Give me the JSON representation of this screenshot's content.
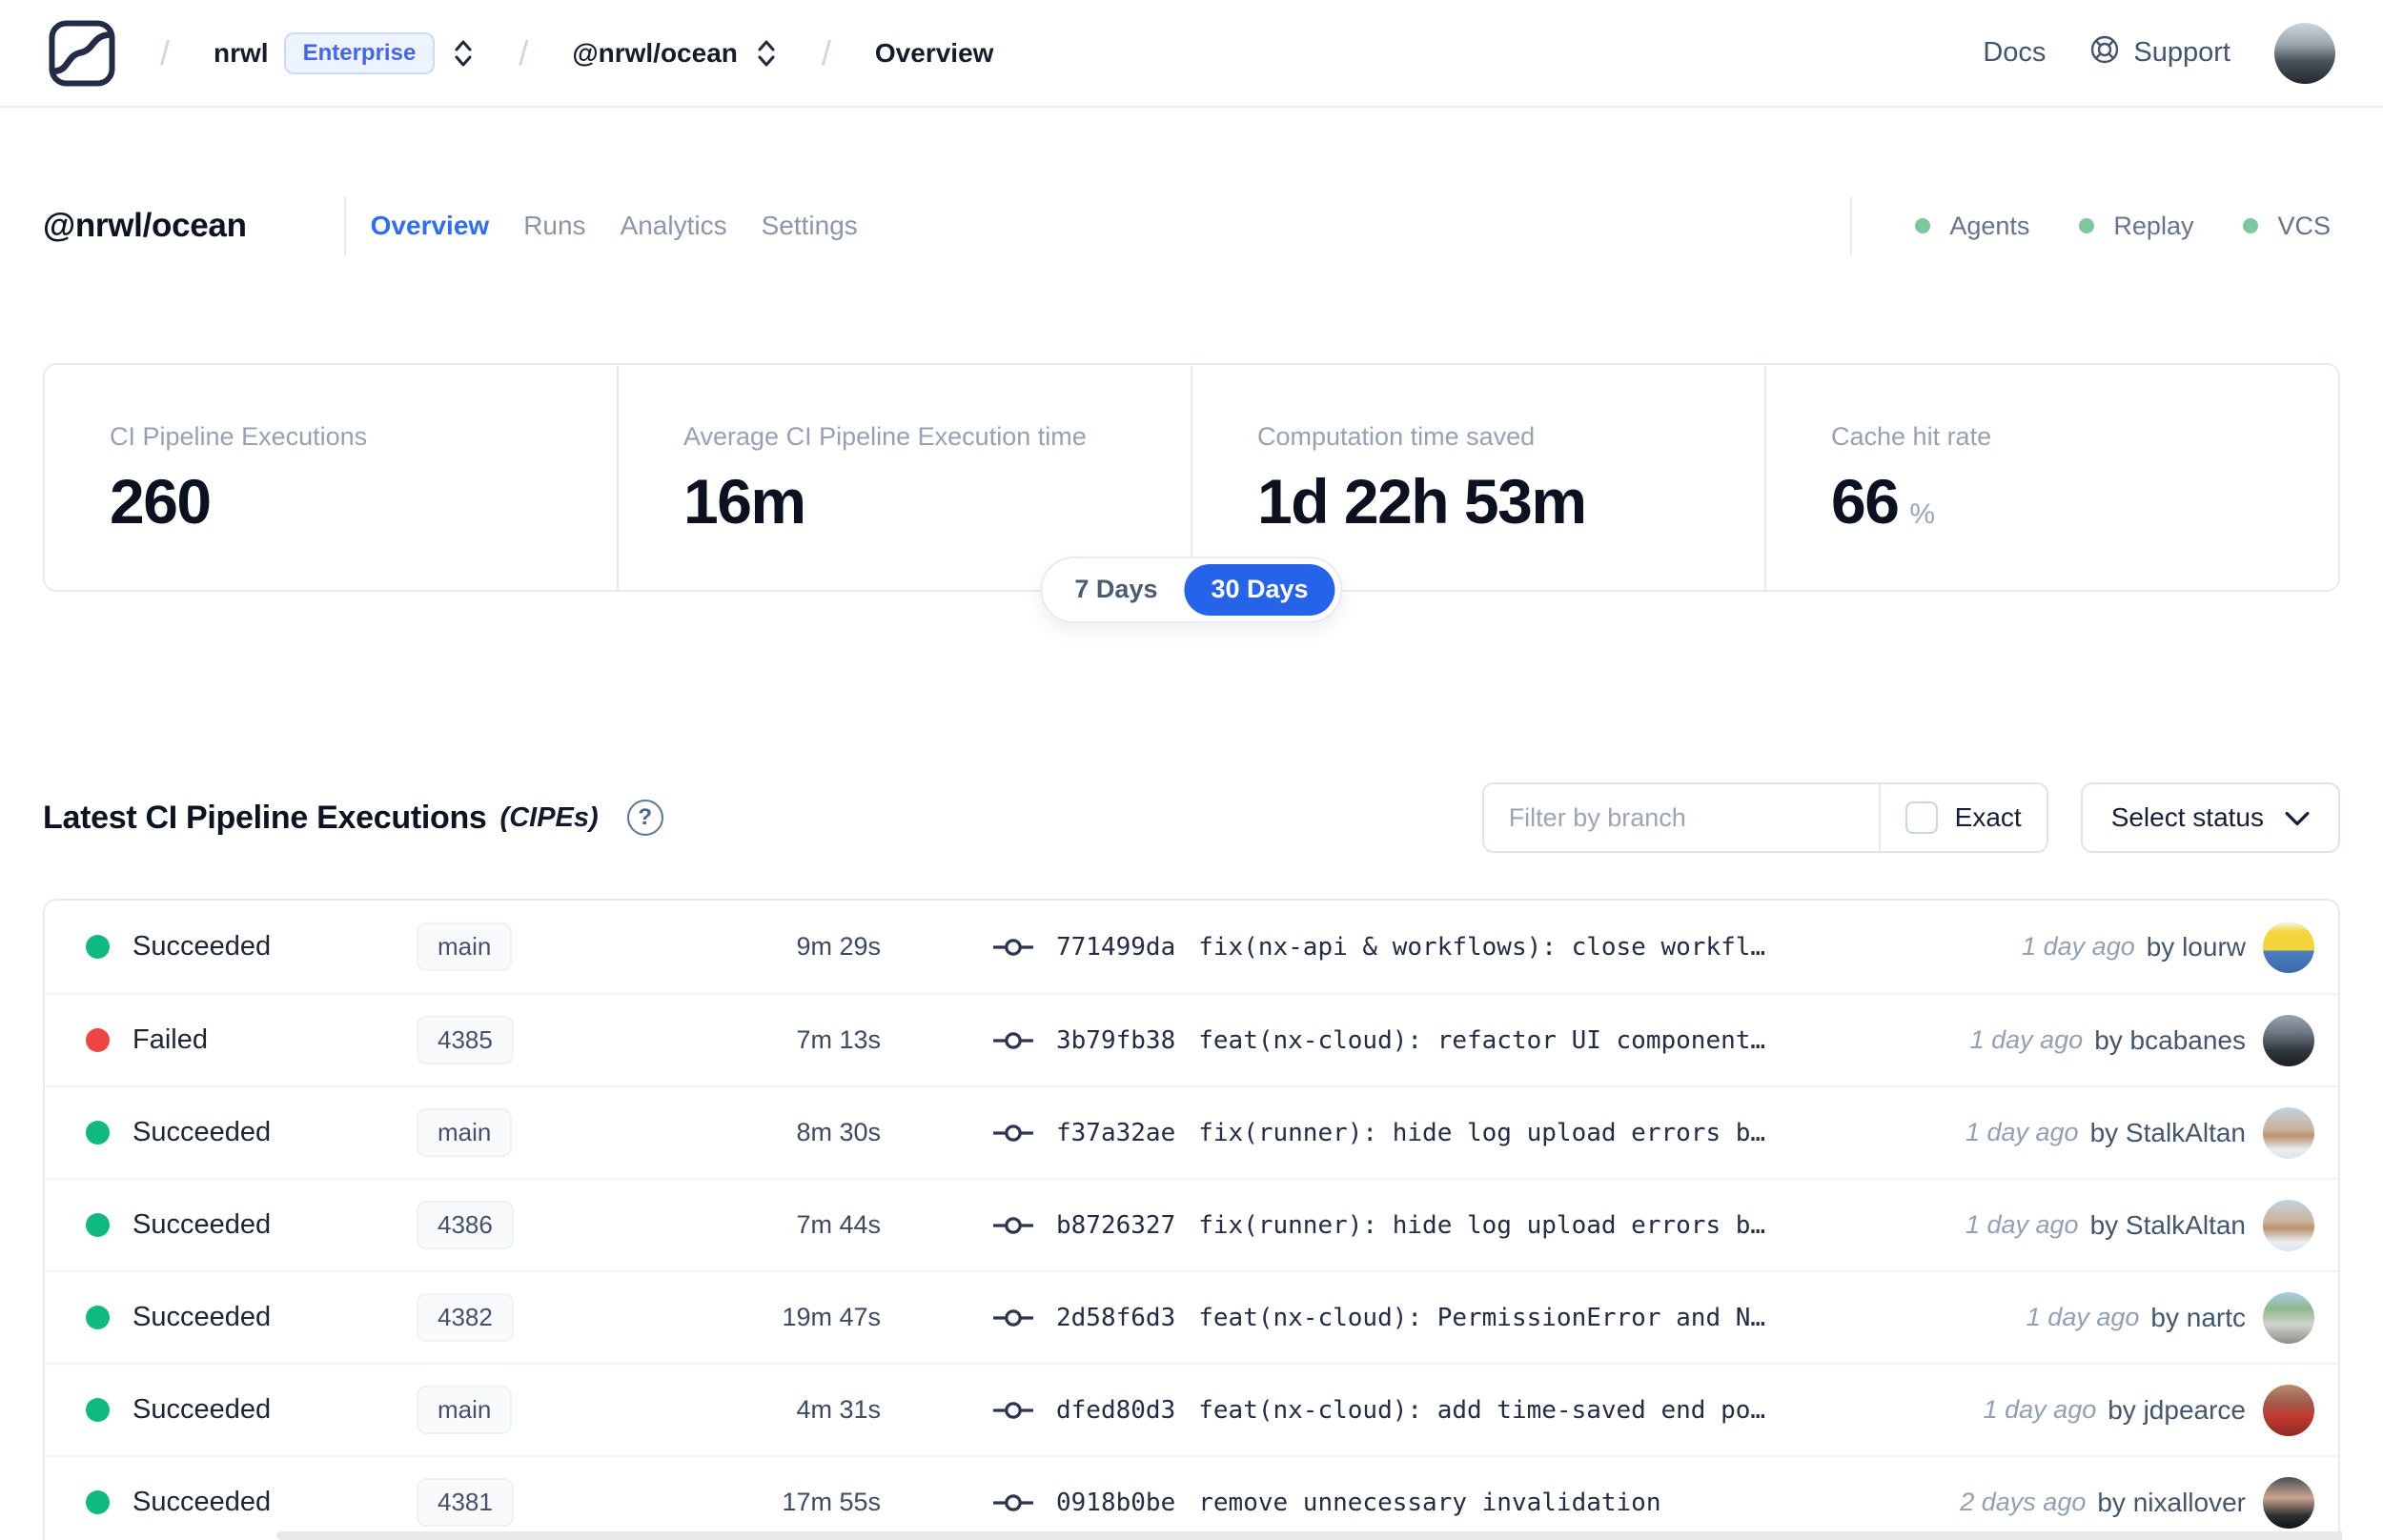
{
  "nav": {
    "separator": "/",
    "org": "nrwl",
    "plan_badge": "Enterprise",
    "workspace": "@nrwl/ocean",
    "page": "Overview",
    "docs": "Docs",
    "support": "Support",
    "avatar_bg": "linear-gradient(180deg,#cdd6dc 0%,#9aa6ae 35%,#4a545c 62%,#23282d 100%)"
  },
  "header": {
    "title": "@nrwl/ocean",
    "tabs": [
      {
        "label": "Overview",
        "active": true
      },
      {
        "label": "Runs",
        "active": false
      },
      {
        "label": "Analytics",
        "active": false
      },
      {
        "label": "Settings",
        "active": false
      }
    ],
    "services": [
      {
        "label": "Agents",
        "dot_color": "#7cc79b"
      },
      {
        "label": "Replay",
        "dot_color": "#7cc79b"
      },
      {
        "label": "VCS",
        "dot_color": "#7cc79b"
      }
    ]
  },
  "stats": {
    "cards": [
      {
        "label": "CI Pipeline Executions",
        "value": "260",
        "suffix": ""
      },
      {
        "label": "Average CI Pipeline Execution time",
        "value": "16m",
        "suffix": ""
      },
      {
        "label": "Computation time saved",
        "value": "1d 22h 53m",
        "suffix": ""
      },
      {
        "label": "Cache hit rate",
        "value": "66",
        "suffix": "%"
      }
    ],
    "range_toggle": {
      "options": [
        "7 Days",
        "30 Days"
      ],
      "selected": "30 Days",
      "selected_bg": "#2563eb"
    }
  },
  "cipes": {
    "title": "Latest CI Pipeline Executions",
    "title_suffix": "(CIPEs)",
    "help_glyph": "?",
    "filter": {
      "placeholder": "Filter by branch",
      "exact_label": "Exact",
      "exact_checked": false,
      "status_button": "Select status"
    },
    "rows": [
      {
        "status": "Succeeded",
        "status_color": "#10b981",
        "branch": "main",
        "duration": "9m 29s",
        "commit": "771499da",
        "message": "fix(nx-api & workflows): close workfl…",
        "time": "1 day ago",
        "author": "by lourw",
        "avatar_bg": "linear-gradient(180deg,#f8f8f6 0%,#f4d53d 20%,#f4d53d 55%,#4a7ec2 58%,#3b69a8 100%)"
      },
      {
        "status": "Failed",
        "status_color": "#ef4444",
        "branch": "4385",
        "duration": "7m 13s",
        "commit": "3b79fb38",
        "message": "feat(nx-cloud): refactor UI component…",
        "time": "1 day ago",
        "author": "by bcabanes",
        "avatar_bg": "linear-gradient(180deg,#9aa4ad 0%,#6b7680 35%,#31363c 70%,#1d2024 100%)"
      },
      {
        "status": "Succeeded",
        "status_color": "#10b981",
        "branch": "main",
        "duration": "8m 30s",
        "commit": "f37a32ae",
        "message": "fix(runner): hide log upload errors b…",
        "time": "1 day ago",
        "author": "by StalkAltan",
        "avatar_bg": "linear-gradient(180deg,#c2d3e0 0%,#ccb39c 42%,#b9936f 55%,#e9edf0 82%,#dfe5ea 100%)"
      },
      {
        "status": "Succeeded",
        "status_color": "#10b981",
        "branch": "4386",
        "duration": "7m 44s",
        "commit": "b8726327",
        "message": "fix(runner): hide log upload errors b…",
        "time": "1 day ago",
        "author": "by StalkAltan",
        "avatar_bg": "linear-gradient(180deg,#c2d3e0 0%,#ccb39c 42%,#b9936f 55%,#e9edf0 82%,#dfe5ea 100%)"
      },
      {
        "status": "Succeeded",
        "status_color": "#10b981",
        "branch": "4382",
        "duration": "19m 47s",
        "commit": "2d58f6d3",
        "message": "feat(nx-cloud): PermissionError and N…",
        "time": "1 day ago",
        "author": "by nartc",
        "avatar_bg": "linear-gradient(180deg,#a8cdea 0%,#90b98b 32%,#cfd3cd 62%,#8f8b85 100%)"
      },
      {
        "status": "Succeeded",
        "status_color": "#10b981",
        "branch": "main",
        "duration": "4m 31s",
        "commit": "dfed80d3",
        "message": "feat(nx-cloud): add time-saved end po…",
        "time": "1 day ago",
        "author": "by jdpearce",
        "avatar_bg": "linear-gradient(180deg,#b98b6f 0%,#a15a4b 35%,#c0392f 62%,#8e2a26 100%)"
      },
      {
        "status": "Succeeded",
        "status_color": "#10b981",
        "branch": "4381",
        "duration": "17m 55s",
        "commit": "0918b0be",
        "message": "remove unnecessary invalidation",
        "time": "2 days ago",
        "author": "by nixallover",
        "avatar_bg": "linear-gradient(180deg,#4a4f55 0%,#caa58f 40%,#2b2e32 75%,#121416 100%)"
      }
    ]
  },
  "colors": {
    "accent_blue": "#2563eb",
    "link_blue": "#2f6df6",
    "success_green": "#10b981",
    "failed_red": "#ef4444",
    "service_dot_green": "#7cc79b"
  }
}
